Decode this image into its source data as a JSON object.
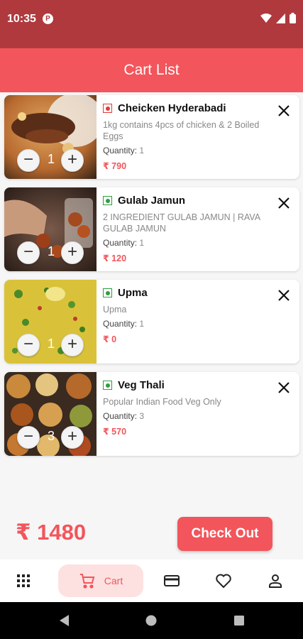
{
  "status_bar": {
    "time": "10:35",
    "app_icon_letter": "P"
  },
  "header": {
    "title": "Cart List"
  },
  "cart_items": [
    {
      "name": "Cheicken Hyderabadi",
      "description": "1kg contains 4pcs of chicken & 2 Boiled Eggs",
      "quantity_label": "Quantity:",
      "quantity": "1",
      "price": "₹ 790",
      "stepper_value": "1",
      "veg": false
    },
    {
      "name": "Gulab Jamun",
      "description": "2 INGREDIENT GULAB JAMUN | RAVA GULAB JAMUN",
      "quantity_label": "Quantity:",
      "quantity": "1",
      "price": "₹ 120",
      "stepper_value": "1",
      "veg": true
    },
    {
      "name": "Upma",
      "description": "Upma",
      "quantity_label": "Quantity:",
      "quantity": "1",
      "price": "₹ 0",
      "stepper_value": "1",
      "veg": true
    },
    {
      "name": "Veg Thali",
      "description": "Popular Indian Food Veg Only",
      "quantity_label": "Quantity:",
      "quantity": "3",
      "price": "₹ 570",
      "stepper_value": "3",
      "veg": true
    }
  ],
  "stepper": {
    "minus": "−",
    "plus": "+"
  },
  "footer": {
    "total": "₹ 1480",
    "checkout_label": "Check Out"
  },
  "bottom_nav": {
    "cart_label": "Cart"
  },
  "colors": {
    "accent": "#f2555b",
    "status_bar": "#b0393e",
    "veg_green": "#2e9e3e",
    "nonveg_red": "#e53935"
  },
  "icons": [
    "grid-icon",
    "cart-icon",
    "card-icon",
    "heart-icon",
    "profile-icon",
    "close-icon",
    "wifi-icon",
    "signal-icon",
    "battery-icon",
    "back-icon",
    "home-icon",
    "recents-icon"
  ]
}
